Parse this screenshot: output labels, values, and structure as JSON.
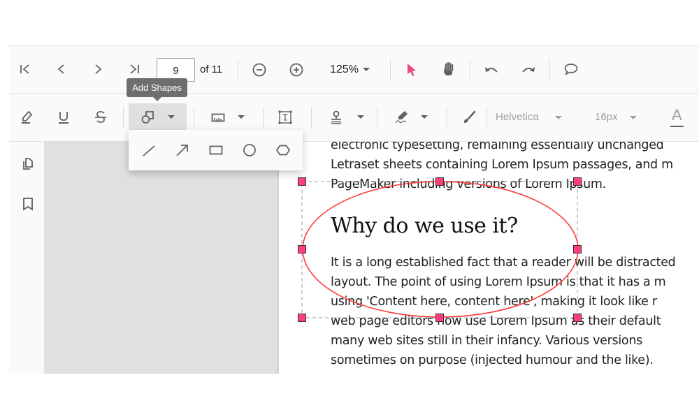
{
  "toolbar_primary": {
    "first_page": "first-page",
    "prev_page": "previous-page",
    "next_page": "next-page",
    "last_page": "last-page",
    "current_page": "9",
    "total_pages_label": "of 11",
    "zoom_out": "zoom-out",
    "zoom_in": "zoom-in",
    "zoom_level": "125%",
    "selection_tool": "text-selection",
    "pan_tool": "pan",
    "undo": "undo",
    "redo": "redo",
    "comment": "comment",
    "accent_color": "#e84c7d"
  },
  "toolbar_annotation": {
    "highlight": "highlight",
    "underline": "underline",
    "strikethrough": "strikethrough",
    "shapes": "shapes",
    "measure": "calibrate",
    "free_text": "free-text",
    "stamp": "stamp",
    "signature": "signature",
    "ink": "ink",
    "font_family": "Helvetica",
    "font_size": "16px",
    "font_color_label": "A"
  },
  "tooltip": {
    "text": "Add Shapes"
  },
  "shapes_menu": {
    "items": [
      "line",
      "arrow",
      "rectangle",
      "circle",
      "polygon"
    ]
  },
  "sidebar": {
    "items": [
      "page-thumbnails",
      "bookmarks"
    ]
  },
  "document": {
    "lines_top": [
      "electronic typesetting, remaining essentially unchanged",
      "Letraset sheets containing Lorem Ipsum passages, and m",
      "PageMaker including versions of Lorem Ipsum."
    ],
    "heading": "Why do we use it?",
    "lines_body": [
      "It is a long established fact that a reader will be distracted",
      "layout. The point of using Lorem Ipsum is that it has a m",
      "using 'Content here, content here', making it look like r",
      "web page editors now use Lorem Ipsum as their default",
      "many web sites still in their infancy. Various versions",
      "sometimes on purpose (injected humour and the like)."
    ]
  },
  "annotation": {
    "type": "ellipse",
    "stroke_color": "#ff0000",
    "handle_color": "#ff3d7f",
    "selected": true
  }
}
